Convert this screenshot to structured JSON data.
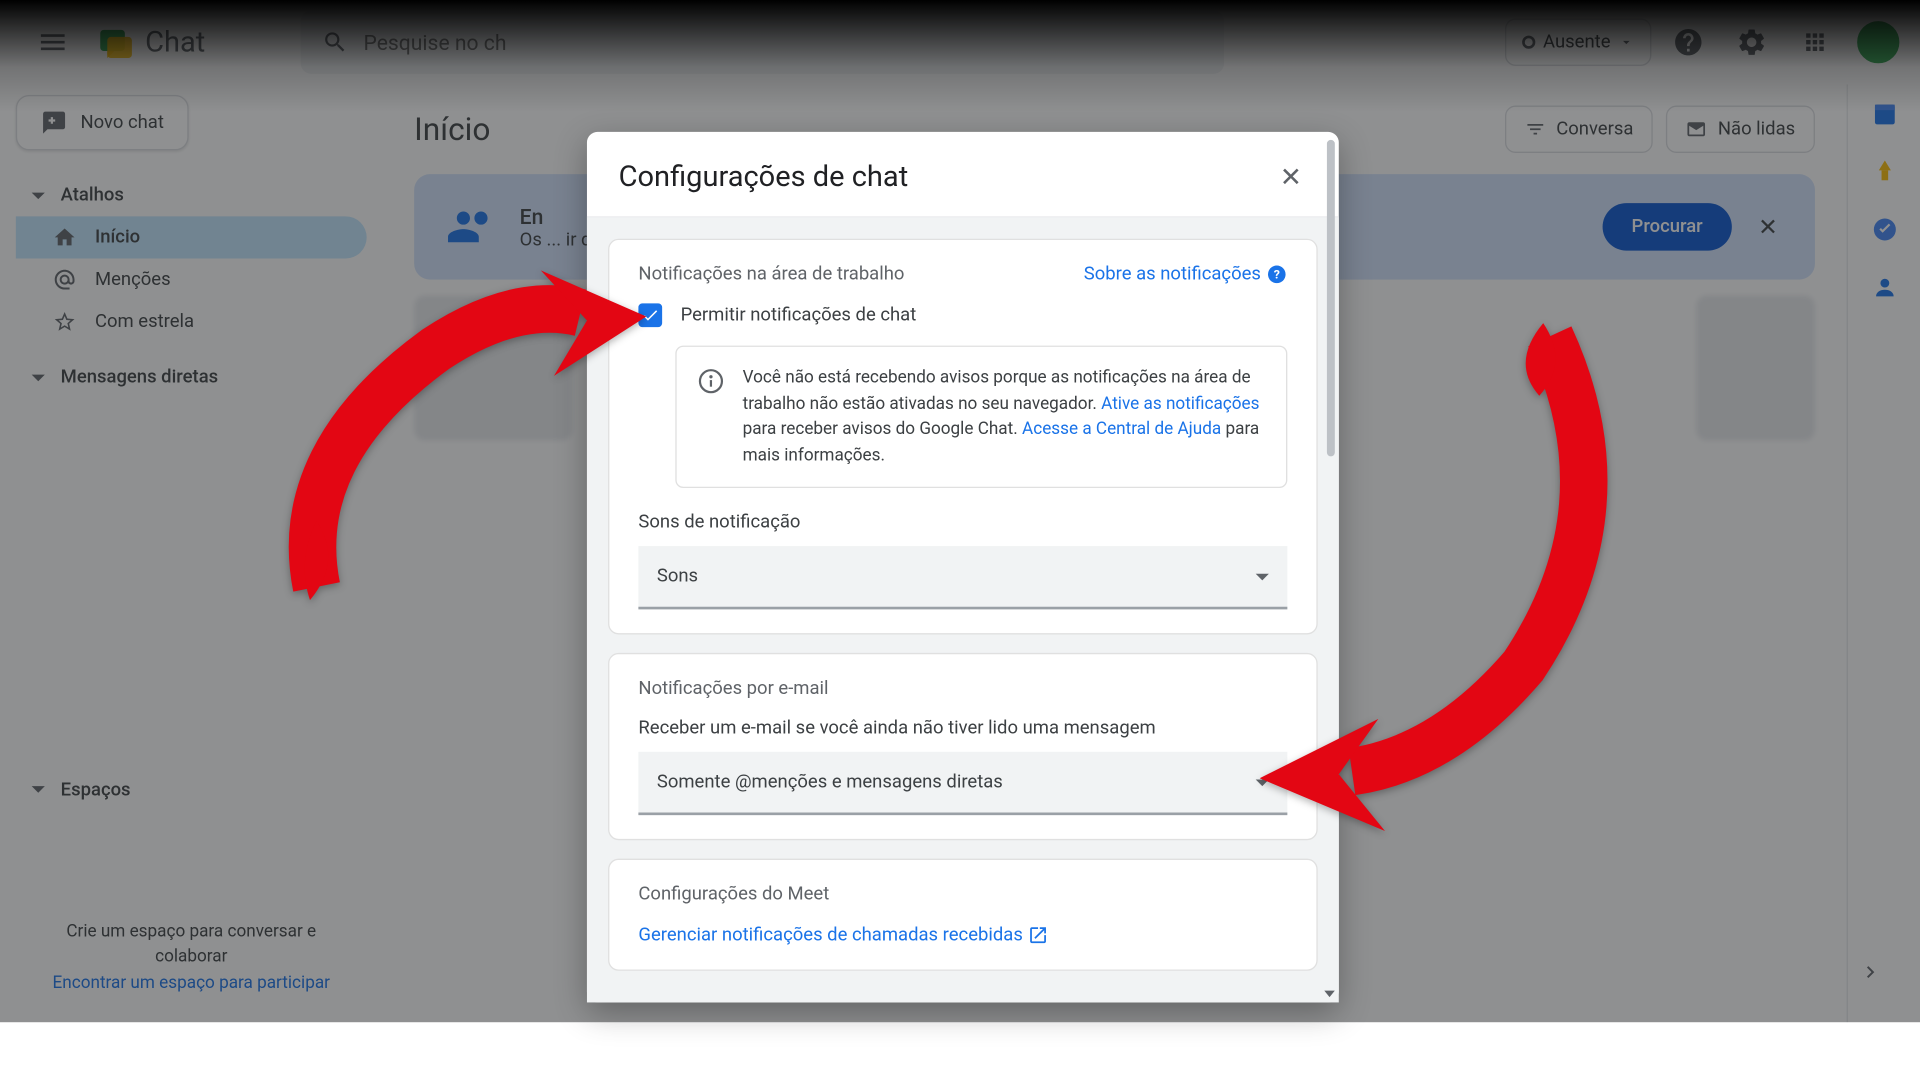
{
  "header": {
    "app_name": "Chat",
    "search_placeholder": "Pesquise no ch",
    "status_label": "Ausente"
  },
  "sidebar": {
    "new_chat": "Novo chat",
    "section_shortcuts": "Atalhos",
    "items": [
      {
        "label": "Início",
        "active": true
      },
      {
        "label": "Menções",
        "active": false
      },
      {
        "label": "Com estrela",
        "active": false
      }
    ],
    "section_dm": "Mensagens diretas",
    "section_spaces": "Espaços",
    "footer_line1": "Crie um espaço para conversar e colaborar",
    "footer_link": "Encontrar um espaço para participar"
  },
  "content": {
    "title": "Início",
    "filter_conversa": "Conversa",
    "filter_unread": "Não lidas",
    "banner_prefix": "En",
    "banner_sub": "Os",
    "banner_suffix": "ir deles quando quiser.",
    "banner_btn": "Procurar"
  },
  "modal": {
    "title": "Configurações de chat",
    "desktop_section": "Notificações na área de trabalho",
    "about_link": "Sobre as notificações",
    "allow_label": "Permitir notificações de chat",
    "info_text1": "Você não está recebendo avisos porque as notificações na área de trabalho não estão ativadas no seu navegador.",
    "info_link1": "Ative as notificações",
    "info_text2": " para receber avisos do Google Chat.",
    "info_link2": "Acesse a Central de Ajuda",
    "info_text3": " para mais informações.",
    "sounds_label": "Sons de notificação",
    "sounds_value": "Sons",
    "email_section": "Notificações por e-mail",
    "email_desc": "Receber um e-mail se você ainda não tiver lido uma mensagem",
    "email_value": "Somente @menções e mensagens diretas",
    "meet_section": "Configurações do Meet",
    "meet_link": "Gerenciar notificações de chamadas recebidas"
  }
}
